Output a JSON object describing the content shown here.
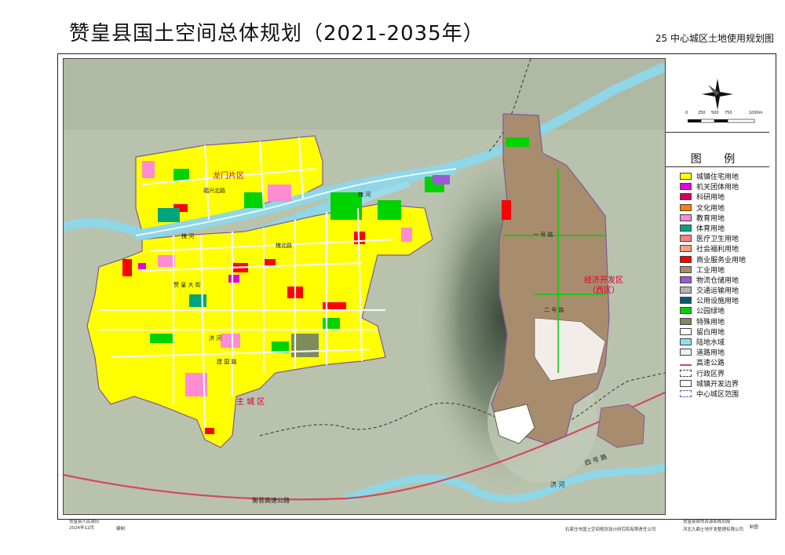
{
  "header": {
    "title": "赞皇县国土空间总体规划（2021-2035年）",
    "subtitle": "25 中心城区土地使用规划图"
  },
  "map": {
    "zone_labels": {
      "longmen": "龙门片区",
      "main": "主 城 区",
      "econ_line1": "经济开发区",
      "econ_line2": "（西区）"
    },
    "road_labels": {
      "highway": "衡昔高速公路",
      "road4": "四 号 路",
      "road1": "一 号 路",
      "road2": "二 号 路",
      "jiheI": "济 河",
      "jiheII": "济 河",
      "huaihe1": "槐 河",
      "huaihe2": "槐 河",
      "huaibei": "槐北路",
      "zanhuang": "赞 皇 大 街",
      "jianguo": "建 国 路",
      "fuxin": "福兴北路"
    }
  },
  "scale": {
    "ticks": [
      "0",
      "250",
      "500",
      "750",
      "1000m"
    ]
  },
  "legend": {
    "title": "图 例",
    "items": [
      {
        "label": "城镇住宅用地",
        "color": "#ffff00"
      },
      {
        "label": "机关团体用地",
        "color": "#e100e1"
      },
      {
        "label": "科研用地",
        "color": "#d6005a"
      },
      {
        "label": "文化用地",
        "color": "#ff7f00"
      },
      {
        "label": "教育用地",
        "color": "#ff8cd2"
      },
      {
        "label": "体育用地",
        "color": "#00a57d"
      },
      {
        "label": "医疗卫生用地",
        "color": "#ff7f7f"
      },
      {
        "label": "社会福利用地",
        "color": "#ff9f7f"
      },
      {
        "label": "商业服务业用地",
        "color": "#ff0000"
      },
      {
        "label": "工业用地",
        "color": "#a88c6e"
      },
      {
        "label": "物流仓储用地",
        "color": "#9b59d6"
      },
      {
        "label": "交通运输用地",
        "color": "#b4b4b4"
      },
      {
        "label": "公用设施用地",
        "color": "#0a5a6e"
      },
      {
        "label": "公园绿地",
        "color": "#00d200"
      },
      {
        "label": "特殊用地",
        "color": "#7d8c5a"
      },
      {
        "label": "留白用地",
        "color": "#ffffff"
      },
      {
        "label": "陆地水域",
        "color": "#8fe0ee"
      },
      {
        "label": "道路用地",
        "color": "#f0f0f0"
      },
      {
        "label": "高速公路",
        "color": "#d24b5a"
      },
      {
        "label": "行政区界",
        "color": "#ffffff"
      },
      {
        "label": "城镇开发边界",
        "color": "#ffffff"
      },
      {
        "label": "中心城区范围",
        "color": "#7d5aa0"
      }
    ]
  },
  "footer": {
    "org1": "赞皇县人民政府",
    "date": "2024年12月",
    "made_by": "编制",
    "dept1": "赞皇县自然资源和规划局",
    "inst1": "石家庄市国土空间规划设计研究院有限责任公司",
    "inst2": "河北九鼎土地开发整理有限公司",
    "drawn_by": "制图"
  }
}
